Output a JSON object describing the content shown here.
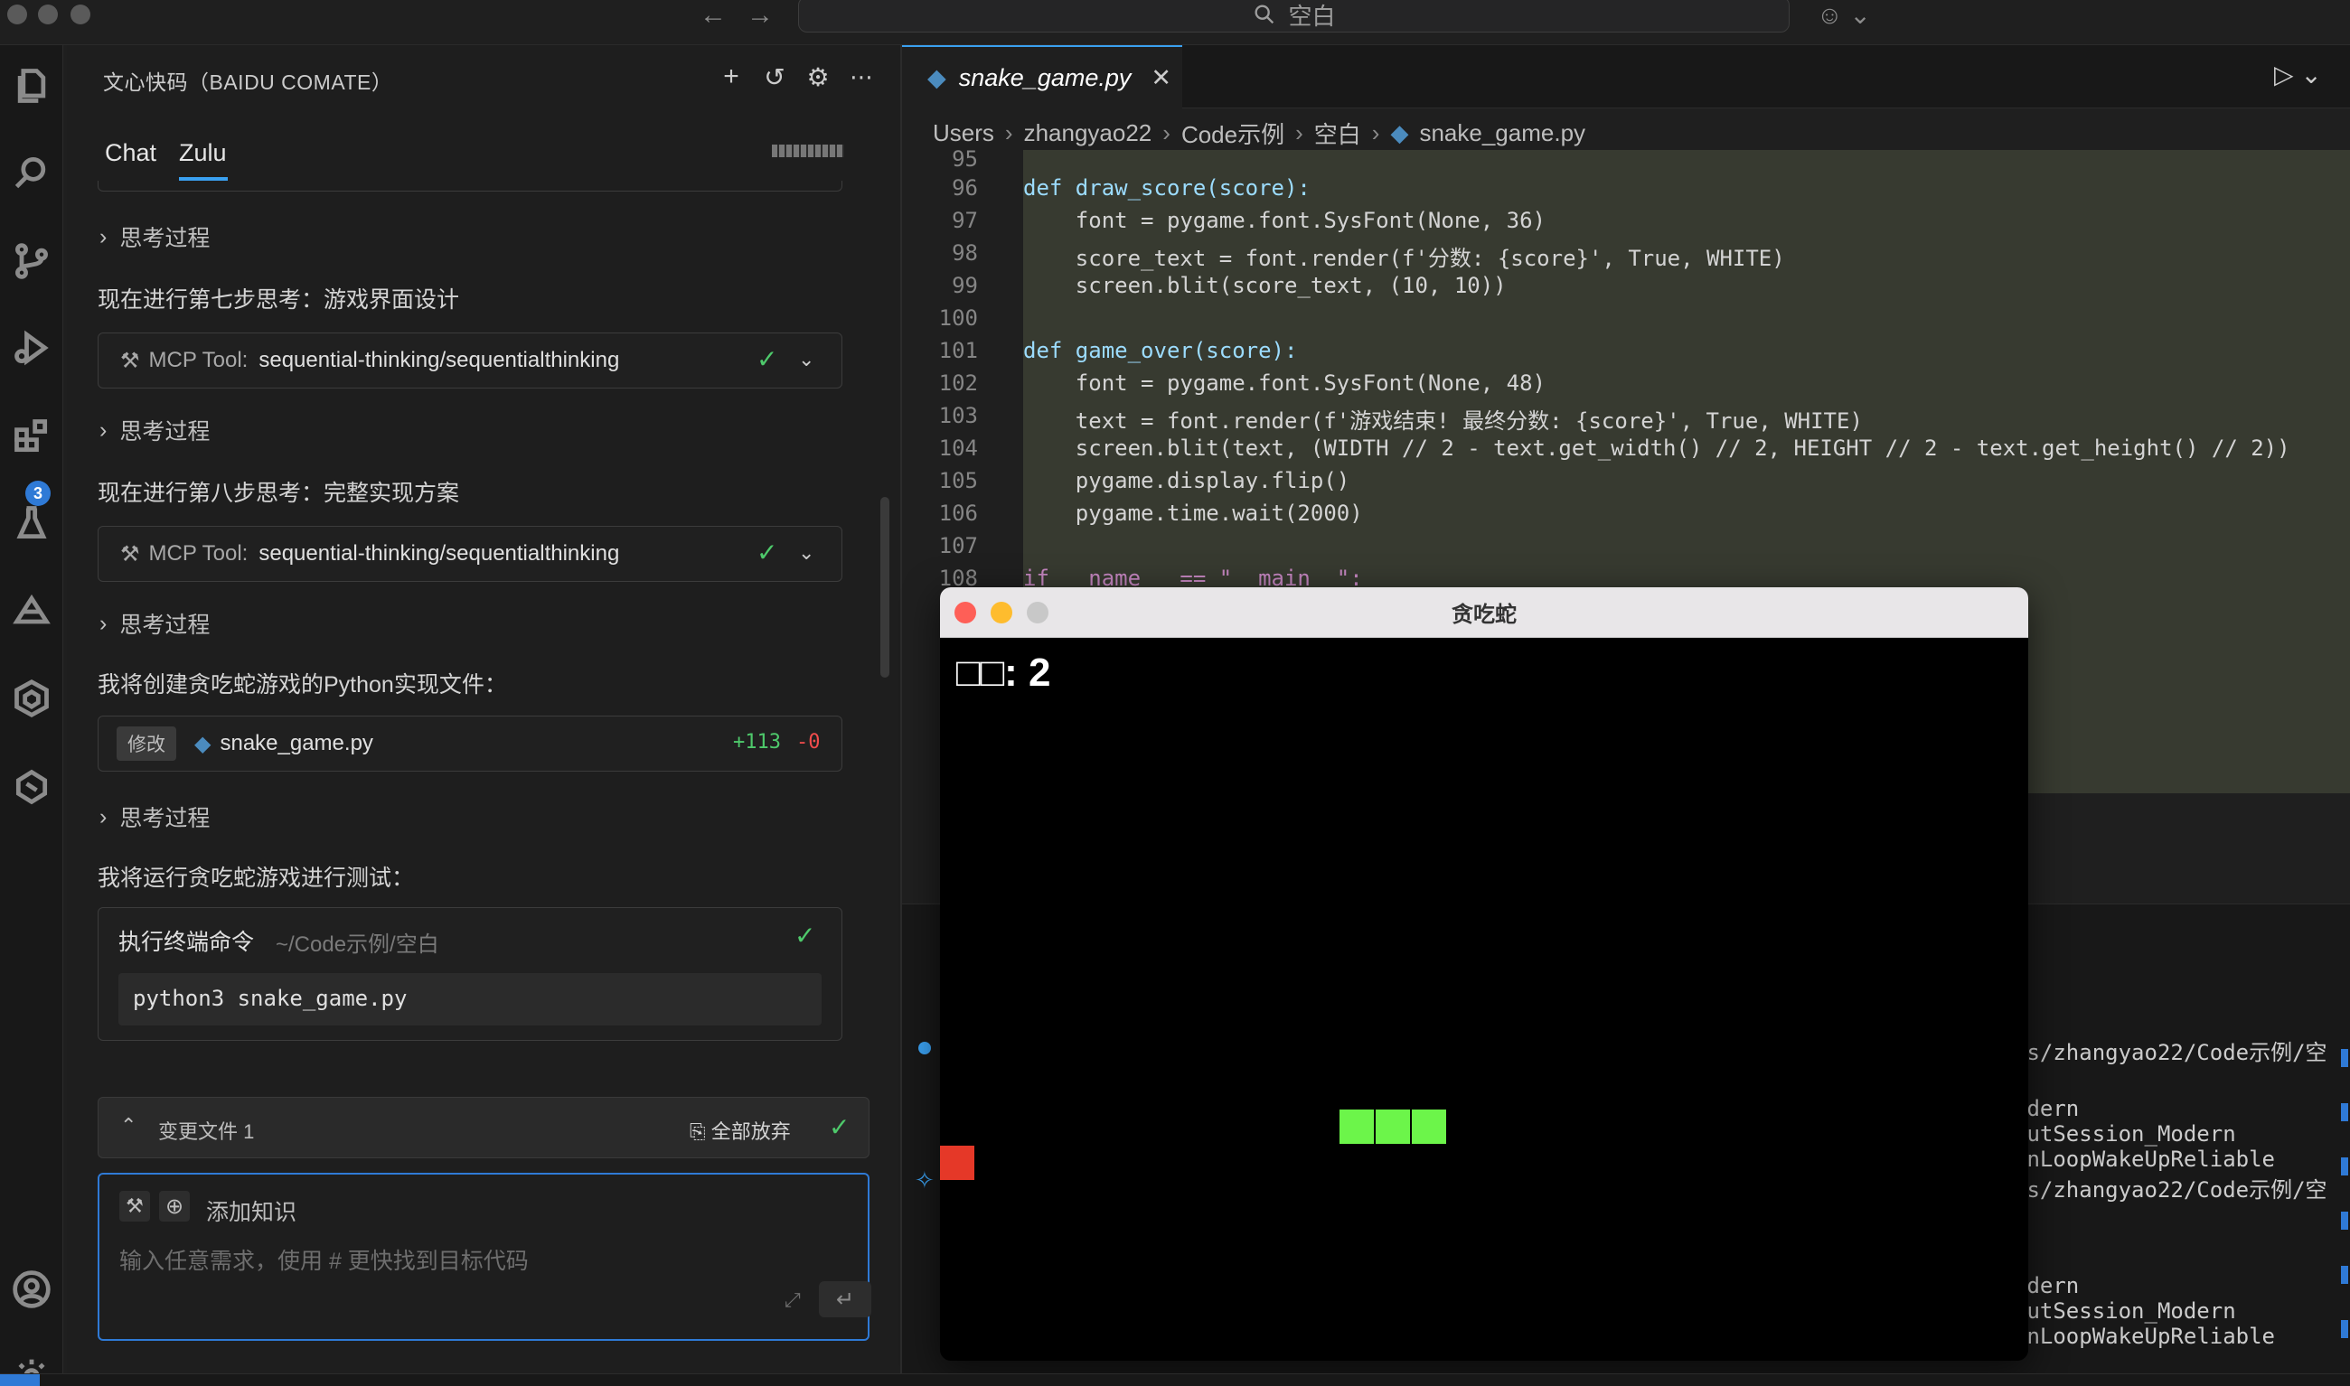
{
  "titlebar": {
    "search_text": "空白"
  },
  "activity_bar": {
    "icons": [
      "explorer-icon",
      "search-icon",
      "source-control-icon",
      "run-debug-icon",
      "extensions-icon",
      "testing-icon",
      "comate-icon",
      "zulu-icon",
      "plugin-icon",
      "account-icon",
      "settings-icon"
    ],
    "extensions_badge": "3"
  },
  "chat_panel": {
    "title": "文心快码（BAIDU COMATE）",
    "tabs": [
      {
        "label": "Chat"
      },
      {
        "label": "Zulu"
      }
    ],
    "active_tab": "Zulu",
    "items": {
      "think1": "思考过程",
      "step7": "现在进行第七步思考：游戏界面设计",
      "tool1_label": "MCP Tool:",
      "tool1_value": "sequential-thinking/sequentialthinking",
      "think2": "思考过程",
      "step8": "现在进行第八步思考：完整实现方案",
      "tool2_label": "MCP Tool:",
      "tool2_value": "sequential-thinking/sequentialthinking",
      "think3": "思考过程",
      "create_msg": "我将创建贪吃蛇游戏的Python实现文件：",
      "file_tag": "修改",
      "file_name": "snake_game.py",
      "added": "+113",
      "removed": "-0",
      "think4": "思考过程",
      "run_msg": "我将运行贪吃蛇游戏进行测试：",
      "terminal_title": "执行终端命令",
      "terminal_path": "~/Code示例/空白",
      "terminal_cmd": "python3 snake_game.py"
    },
    "changes": {
      "label": "变更文件 1",
      "discard_all": "全部放弃"
    },
    "input": {
      "add_knowledge": "添加知识",
      "placeholder": "输入任意需求，使用 # 更快找到目标代码"
    }
  },
  "editor": {
    "tab_name": "snake_game.py",
    "breadcrumb": [
      "Users",
      "zhangyao22",
      "Code示例",
      "空白",
      "snake_game.py"
    ],
    "lines": [
      {
        "n": "95"
      },
      {
        "n": "96"
      },
      {
        "n": "97"
      },
      {
        "n": "98"
      },
      {
        "n": "99"
      },
      {
        "n": "100"
      },
      {
        "n": "101"
      },
      {
        "n": "102"
      },
      {
        "n": "103"
      },
      {
        "n": "104"
      },
      {
        "n": "105"
      },
      {
        "n": "106"
      },
      {
        "n": "107"
      },
      {
        "n": "108"
      }
    ],
    "code": {
      "l96": "def draw_score(score):",
      "l97": "    font = pygame.font.SysFont(None, 36)",
      "l98": "    score_text = font.render(f'分数: {score}', True, WHITE)",
      "l99": "    screen.blit(score_text, (10, 10))",
      "l101": "def game_over(score):",
      "l102": "    font = pygame.font.SysFont(None, 48)",
      "l103": "    text = font.render(f'游戏结束! 最终分数: {score}', True, WHITE)",
      "l104": "    screen.blit(text, (WIDTH // 2 - text.get_width() // 2, HEIGHT // 2 - text.get_height() // 2))",
      "l105": "    pygame.display.flip()",
      "l106": "    pygame.time.wait(2000)",
      "l108": "if __name__ == \"__main__\":"
    }
  },
  "terminal": {
    "lines": [
      "rs/zhangyao22/Code示例/空",
      "odern",
      "outSession_Modern",
      "unLoopWakeUpReliable",
      "rs/zhangyao22/Code示例/空",
      "odern",
      "outSession_Modern",
      "unLoopWakeUpReliable"
    ]
  },
  "game_window": {
    "title": "贪吃蛇",
    "score_text": "□□: 2",
    "colors": {
      "snake": "#6cf54a",
      "food": "#e53828",
      "background": "#000000"
    }
  },
  "colors": {
    "accent": "#3aa0f0",
    "check": "#4ec96b",
    "added": "#4ec96b",
    "removed": "#f14c4c"
  }
}
